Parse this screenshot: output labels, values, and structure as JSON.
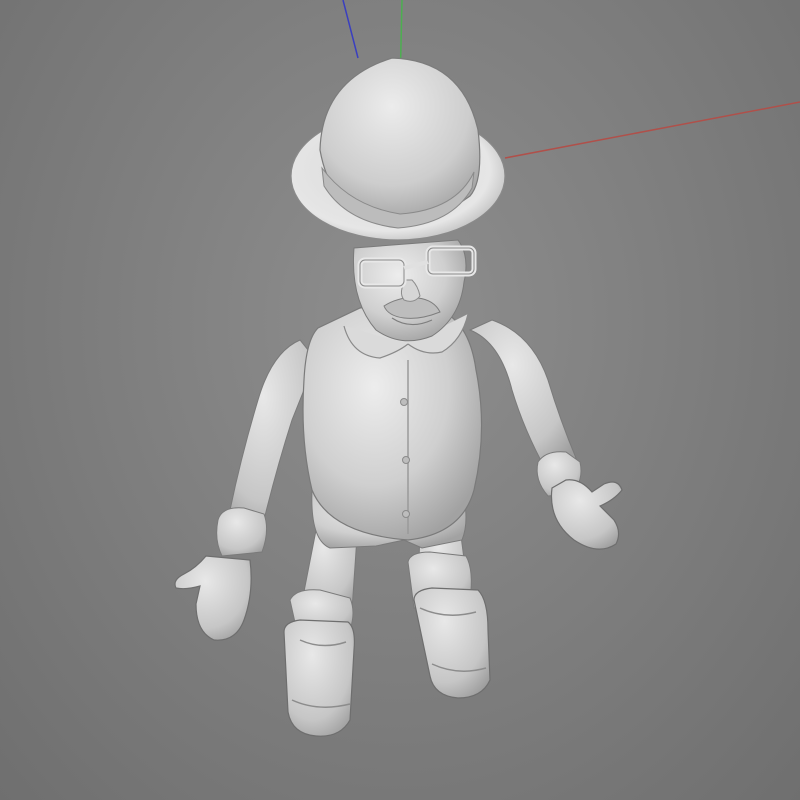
{
  "viewport": {
    "background_top": "#8e8e8e",
    "background_bottom": "#6f6f6f"
  },
  "axes": {
    "x_color": "#b0504a",
    "y_color": "#4caf50",
    "z_color": "#3a3fbf"
  },
  "model": {
    "base_color": "#d2d2d2",
    "shade_color": "#a9a9a9",
    "dark_color": "#8a8a8a",
    "highlight_color": "#ececec",
    "outline_color": "#6e6e6e"
  }
}
